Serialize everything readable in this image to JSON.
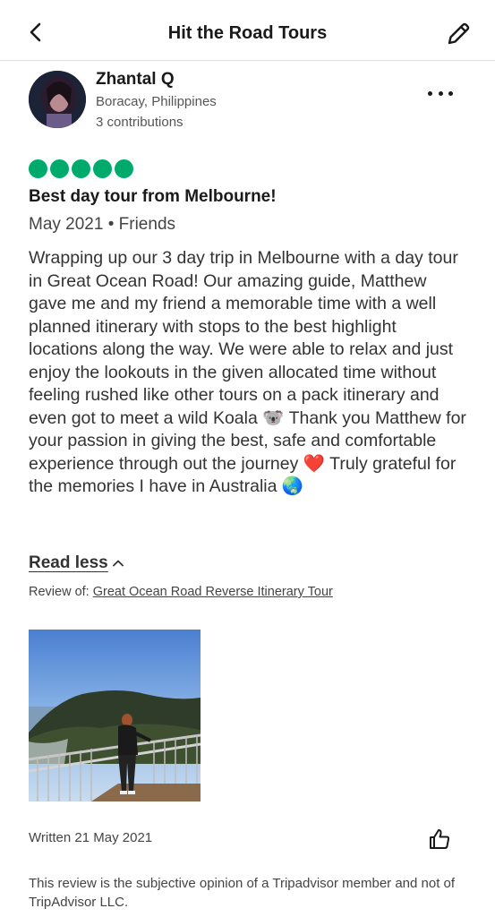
{
  "header": {
    "title": "Hit the Road Tours",
    "back_icon": "chevron-left-icon",
    "edit_icon": "pencil-icon"
  },
  "reviewer": {
    "name": "Zhantal Q",
    "location": "Boracay, Philippines",
    "contributions": "3 contributions"
  },
  "review": {
    "rating": 5,
    "rating_color": "#00aa6c",
    "title": "Best day tour from Melbourne!",
    "meta": "May 2021 • Friends",
    "body": "Wrapping up our 3 day trip in Melbourne with a day tour in Great Ocean Road! Our amazing guide, Matthew gave me and my friend a memorable time with a well planned itinerary with stops to the best highlight locations along the way. We were able to relax and just enjoy the lookouts in the given allocated time without feeling rushed like other tours on a pack itinerary and even got to meet a wild Koala 🐨 Thank you Matthew for your passion in giving the best, safe and comfortable experience through out the journey ❤️ Truly grateful for the memories I have in Australia 🌏",
    "read_less_label": "Read less",
    "review_of_label": "Review of:",
    "review_of_link": "Great Ocean Road Reverse Itinerary Tour",
    "written": "Written 21 May 2021",
    "like_icon": "thumbs-up-icon"
  },
  "disclaimer": "This review is the subjective opinion of a Tripadvisor member and not of TripAdvisor LLC."
}
